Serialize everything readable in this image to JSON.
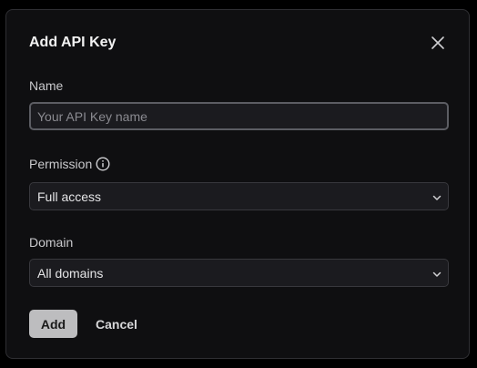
{
  "dialog": {
    "title": "Add API Key",
    "close_icon": "close-icon"
  },
  "fields": {
    "name": {
      "label": "Name",
      "value": "",
      "placeholder": "Your API Key name"
    },
    "permission": {
      "label": "Permission",
      "info_icon": "info-icon",
      "selected": "Full access"
    },
    "domain": {
      "label": "Domain",
      "selected": "All domains"
    }
  },
  "actions": {
    "add_label": "Add",
    "cancel_label": "Cancel"
  },
  "colors": {
    "background": "#0f0f11",
    "primary_button": "#bdbdbf",
    "focus_border": "#5c5d63"
  }
}
